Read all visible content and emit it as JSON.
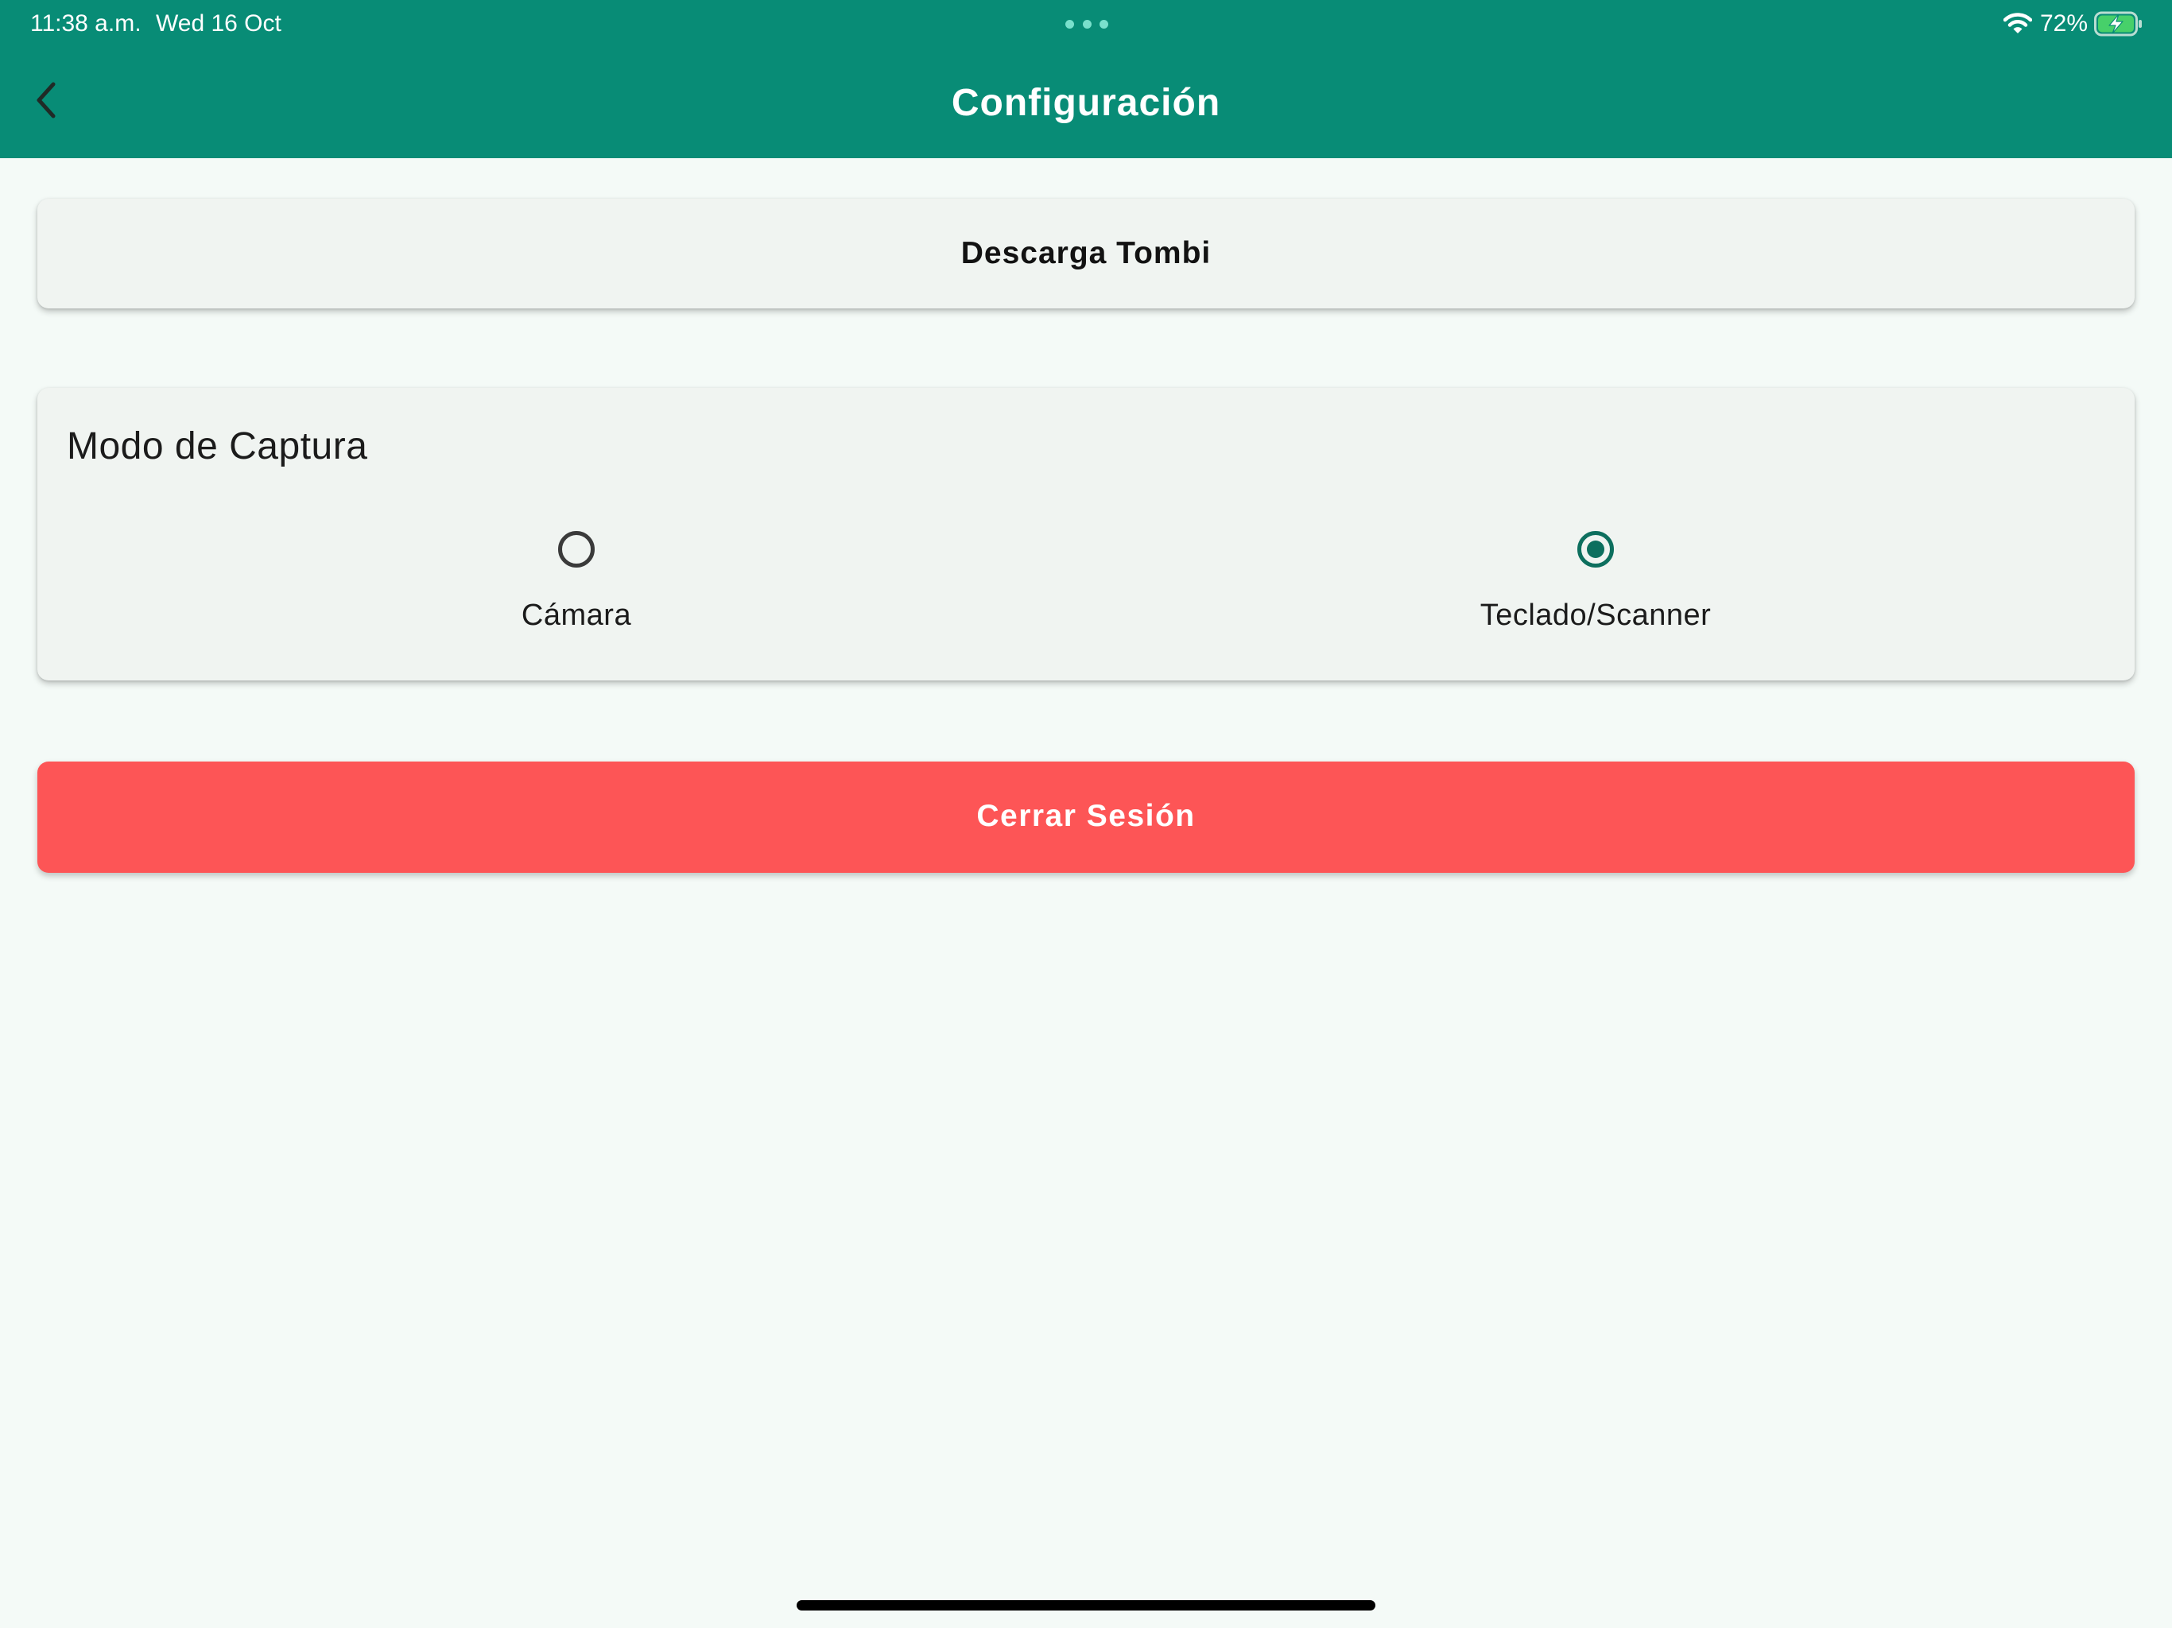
{
  "status_bar": {
    "time": "11:38 a.m.",
    "date": "Wed 16 Oct",
    "battery": "72%",
    "battery_level": 0.72
  },
  "header": {
    "title": "Configuración",
    "back_icon": "chevron-left-icon"
  },
  "download_card": {
    "label": "Descarga Tombi"
  },
  "capture_mode": {
    "title": "Modo de Captura",
    "options": [
      {
        "label": "Cámara",
        "selected": false
      },
      {
        "label": "Teclado/Scanner",
        "selected": true
      }
    ]
  },
  "logout": {
    "label": "Cerrar Sesión"
  },
  "colors": {
    "header": "#088c76",
    "background": "#f4faf7",
    "card": "#f0f4f1",
    "radio_selected": "#0d6f5e",
    "logout_button": "#fd5556"
  }
}
